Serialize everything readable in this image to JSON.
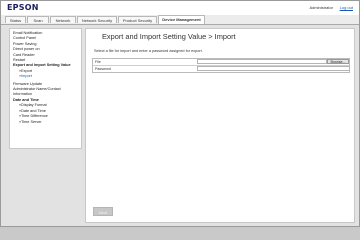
{
  "header": {
    "logo": "EPSON",
    "admin_label": "Administrator",
    "logout_label": "Log out"
  },
  "tabs": [
    {
      "label": "Status"
    },
    {
      "label": "Scan"
    },
    {
      "label": "Network"
    },
    {
      "label": "Network Security"
    },
    {
      "label": "Product Security"
    },
    {
      "label": "Device Management",
      "active": true
    }
  ],
  "sidebar": {
    "items": [
      {
        "label": "Email Notification"
      },
      {
        "label": "Control Panel"
      },
      {
        "label": "Power Saving"
      },
      {
        "label": "Direct power on"
      },
      {
        "label": "Card Reader"
      },
      {
        "label": "Restart"
      },
      {
        "label": "Export and Import Setting Value"
      },
      {
        "label": "»Export"
      },
      {
        "label": "»Import"
      },
      {
        "label": "Firmware Update"
      },
      {
        "label": "Administrator Name/Contact Information"
      },
      {
        "label": "Date and Time"
      },
      {
        "label": "»Display Format"
      },
      {
        "label": "»Date and Time"
      },
      {
        "label": "»Time Difference"
      },
      {
        "label": "»Time Server"
      }
    ]
  },
  "main": {
    "title": "Export and Import Setting Value > Import",
    "instruction": "Select a file for import and enter a password assigned for export.",
    "fields": {
      "file_label": "File",
      "file_value": "",
      "browse_label": "Browse...",
      "password_label": "Password",
      "password_value": ""
    },
    "next_label": "Next"
  }
}
